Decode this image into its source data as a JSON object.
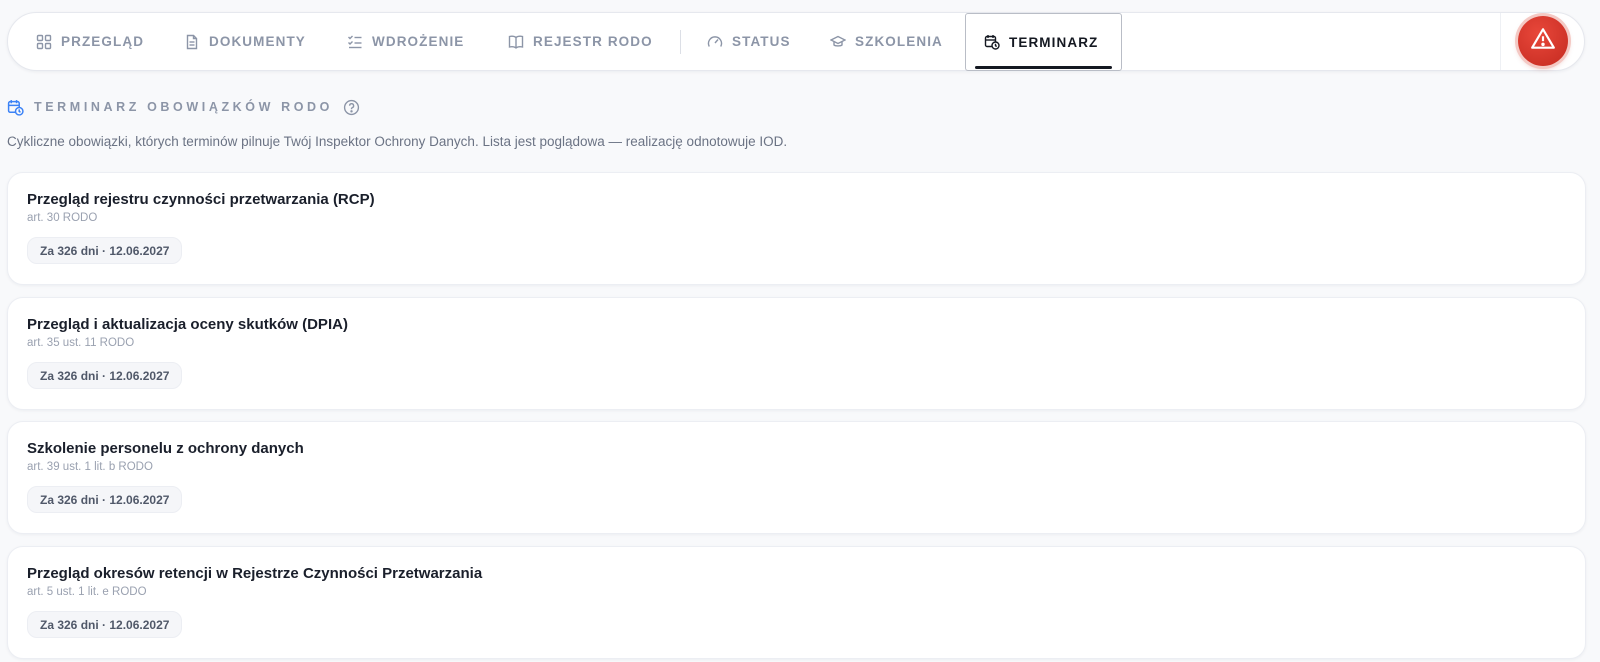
{
  "nav": {
    "tabs": [
      {
        "label": "PRZEGLĄD",
        "icon": "grid-icon"
      },
      {
        "label": "DOKUMENTY",
        "icon": "document-icon"
      },
      {
        "label": "WDROŻENIE",
        "icon": "checklist-icon"
      },
      {
        "label": "REJESTR RODO",
        "icon": "book-icon"
      },
      {
        "label": "STATUS",
        "icon": "gauge-icon"
      },
      {
        "label": "SZKOLENIA",
        "icon": "graduation-cap-icon"
      },
      {
        "label": "TERMINARZ",
        "icon": "calendar-clock-icon",
        "active": true
      }
    ],
    "alert_icon": "warning-icon"
  },
  "section": {
    "title": "TERMINARZ OBOWIĄZKÓW RODO",
    "description": "Cykliczne obowiązki, których terminów pilnuje Twój Inspektor Ochrony Danych. Lista jest poglądowa — realizację odnotowuje IOD."
  },
  "items": [
    {
      "title": "Przegląd rejestru czynności przetwarzania (RCP)",
      "article": "art. 30 RODO",
      "due": "Za 326 dni · 12.06.2027"
    },
    {
      "title": "Przegląd i aktualizacja oceny skutków (DPIA)",
      "article": "art. 35 ust. 11 RODO",
      "due": "Za 326 dni · 12.06.2027"
    },
    {
      "title": "Szkolenie personelu z ochrony danych",
      "article": "art. 39 ust. 1 lit. b RODO",
      "due": "Za 326 dni · 12.06.2027"
    },
    {
      "title": "Przegląd okresów retencji w Rejestrze Czynności Przetwarzania",
      "article": "art. 5 ust. 1 lit. e RODO",
      "due": "Za 326 dni · 12.06.2027"
    }
  ],
  "colors": {
    "accent_blue": "#3b82f6",
    "alert_red": "#d9362b",
    "muted_text": "#8c95a7"
  }
}
